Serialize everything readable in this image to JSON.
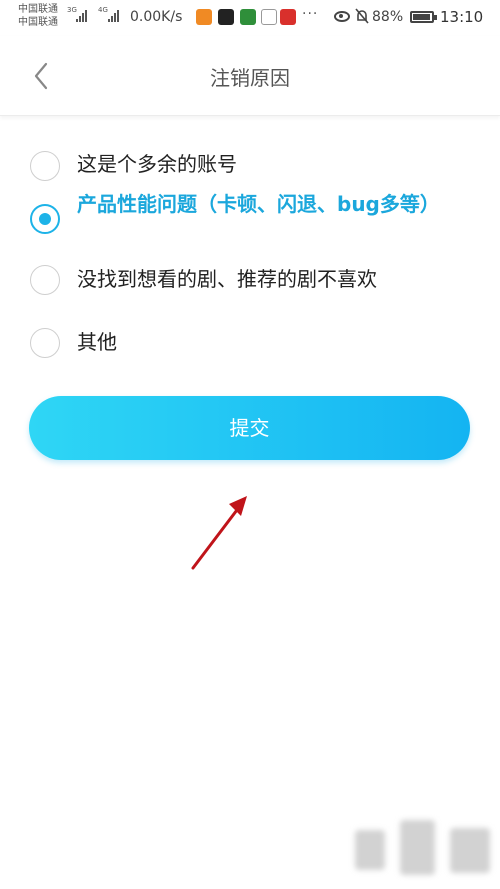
{
  "status_bar": {
    "carrier_line1": "中国联通",
    "carrier_line2": "中国联通",
    "network_1": "3G",
    "network_2": "4G",
    "speed": "0.00K/s",
    "more": "···",
    "battery_percent": "88%",
    "battery_level": 0.88,
    "time": "13:10",
    "icons": [
      "signal-icon",
      "app-icon-orange",
      "app-icon-black",
      "app-icon-green",
      "app-icon-text",
      "app-icon-red",
      "eye-icon",
      "bell-off-icon",
      "battery-icon"
    ]
  },
  "header": {
    "title": "注销原因",
    "back_icon": "chevron-left-icon"
  },
  "options": [
    {
      "label": "这是个多余的账号",
      "selected": false
    },
    {
      "label": "产品性能问题（卡顿、闪退、bug多等）",
      "selected": true
    },
    {
      "label": "没找到想看的剧、推荐的剧不喜欢",
      "selected": false
    },
    {
      "label": "其他",
      "selected": false
    }
  ],
  "submit": {
    "label": "提交"
  },
  "colors": {
    "accent": "#1db3e8",
    "button_gradient_start": "#2fd6f5",
    "button_gradient_end": "#14b4f2",
    "annotation_arrow": "#c0141a"
  }
}
